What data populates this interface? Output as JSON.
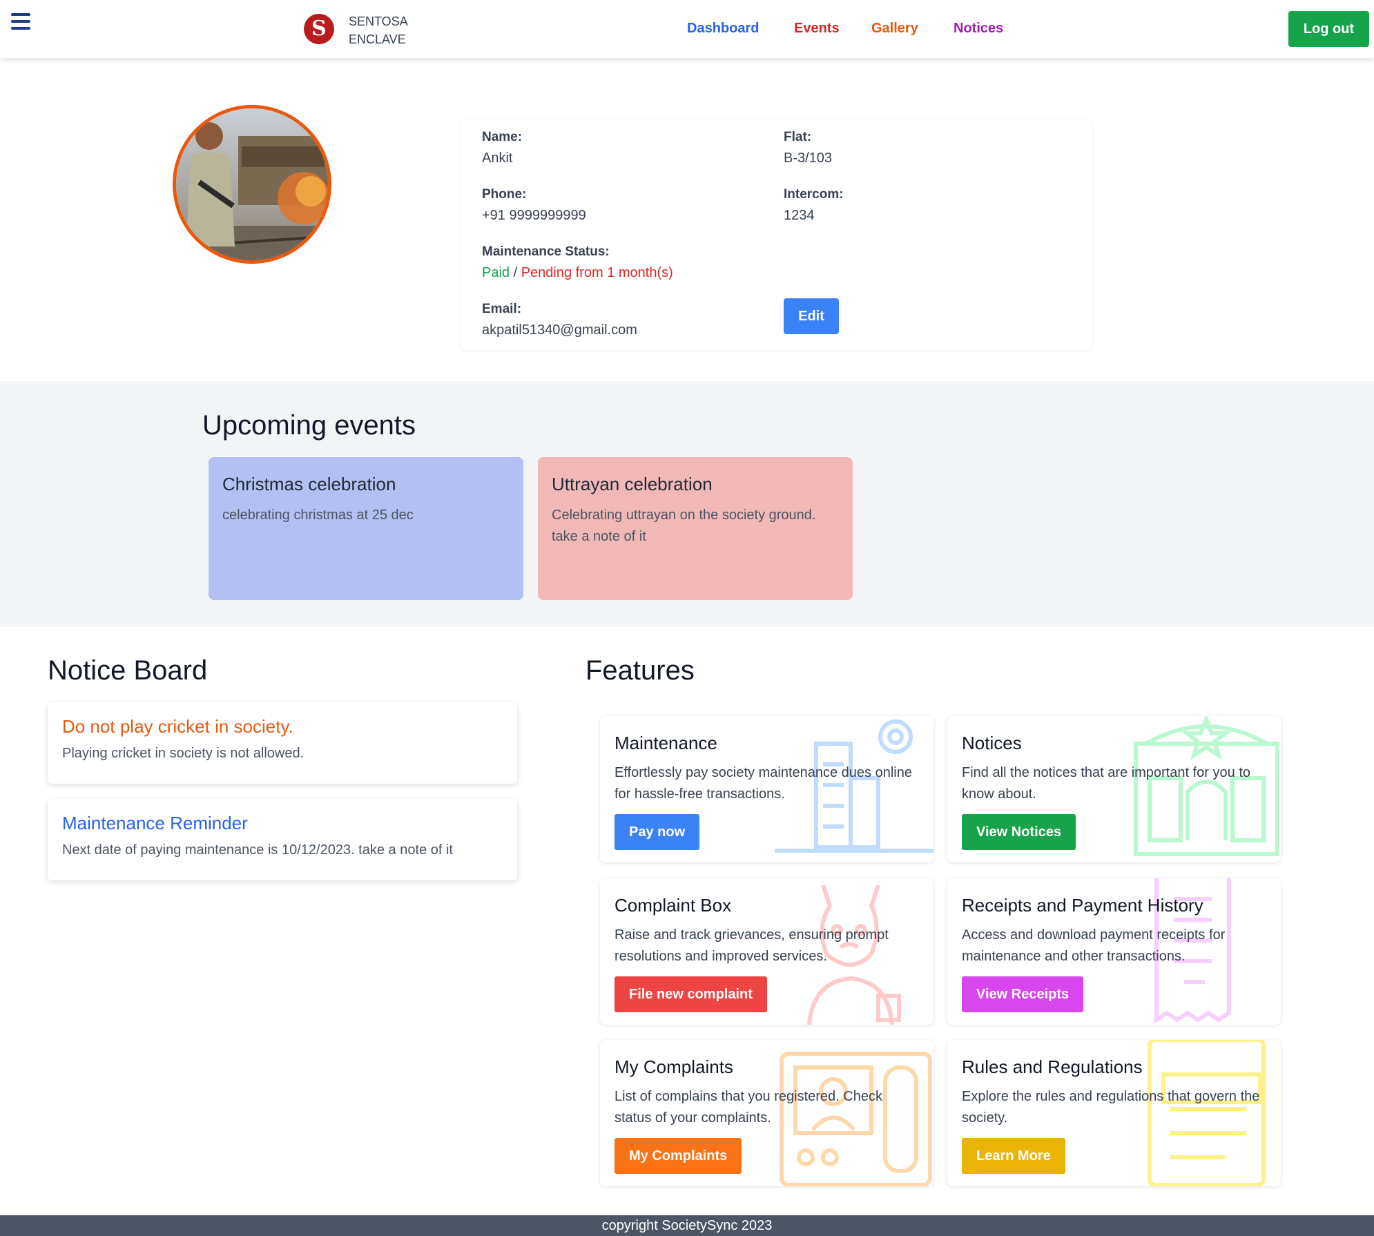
{
  "header": {
    "brand_line1": "SENTOSA",
    "brand_line2": "ENCLAVE",
    "logo_glyph": "S",
    "nav": [
      {
        "label": "Dashboard",
        "color": "#2563eb"
      },
      {
        "label": "Events",
        "color": "#dc2626"
      },
      {
        "label": "Gallery",
        "color": "#ea580c"
      },
      {
        "label": "Notices",
        "color": "#a21caf"
      }
    ],
    "logout_label": "Log out"
  },
  "profile": {
    "name_label": "Name:",
    "name": "Ankit",
    "flat_label": "Flat:",
    "flat": "B-3/103",
    "phone_label": "Phone:",
    "phone": "+91 9999999999",
    "intercom_label": "Intercom:",
    "intercom": "1234",
    "maintenance_label": "Maintenance Status:",
    "maintenance_paid": "Paid",
    "maintenance_separator": " / ",
    "maintenance_pending": "Pending from 1 month(s)",
    "email_label": "Email:",
    "email": "akpatil51340@gmail.com",
    "edit_label": "Edit"
  },
  "events": {
    "title": "Upcoming events",
    "items": [
      {
        "title": "Christmas celebration",
        "desc": "celebrating christmas at 25 dec",
        "color": "#b4c0f3"
      },
      {
        "title": "Uttrayan celebration",
        "desc": "Celebrating uttrayan on the society ground. take a note of it",
        "color": "#f2b8b8"
      }
    ]
  },
  "notice_board": {
    "title": "Notice Board",
    "items": [
      {
        "title": "Do not play cricket in society.",
        "desc": "Playing cricket in society is not allowed.",
        "color": "#ea580c"
      },
      {
        "title": "Maintenance Reminder",
        "desc": "Next date of paying maintenance is 10/12/2023. take a note of it",
        "color": "#2563eb"
      }
    ]
  },
  "features": {
    "title": "Features",
    "items": [
      {
        "title": "Maintenance",
        "desc": "Effortlessly pay society maintenance dues online for hassle-free transactions.",
        "button": "Pay now",
        "color": "#3b82f6",
        "icon": "building-gear-icon"
      },
      {
        "title": "Notices",
        "desc": "Find all the notices that are important for you to know about.",
        "button": "View Notices",
        "color": "#16a34a",
        "icon": "notice-board-icon"
      },
      {
        "title": "Complaint Box",
        "desc": "Raise and track grievances, ensuring prompt resolutions and improved services.",
        "button": "File new complaint",
        "color": "#ef4444",
        "icon": "angry-person-icon"
      },
      {
        "title": "Receipts and Payment History",
        "desc": "Access and download payment receipts for maintenance and other transactions.",
        "button": "View Receipts",
        "color": "#d946ef",
        "icon": "receipt-icon"
      },
      {
        "title": "My Complaints",
        "desc": "List of complains that you registered. Check status of your complaints.",
        "button": "My Complaints",
        "color": "#f97316",
        "icon": "intercom-icon"
      },
      {
        "title": "Rules and Regulations",
        "desc": "Explore the rules and regulations that govern the society.",
        "button": "Learn More",
        "color": "#eab308",
        "icon": "rules-book-icon"
      }
    ]
  },
  "footer": {
    "text": "copyright SocietySync 2023"
  }
}
